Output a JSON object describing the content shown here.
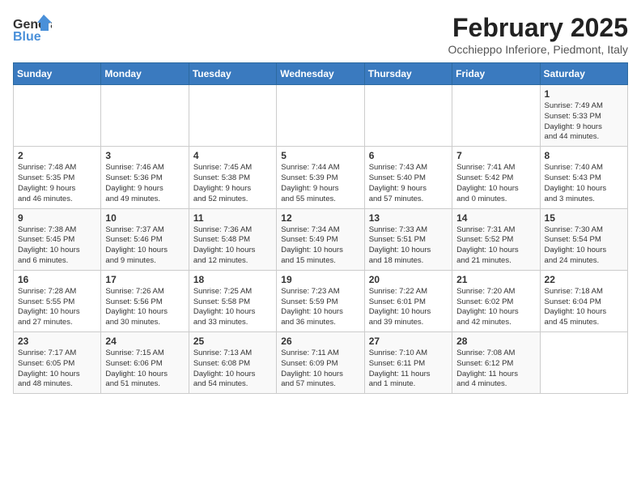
{
  "logo": {
    "line1": "General",
    "line2": "Blue"
  },
  "title": "February 2025",
  "subtitle": "Occhieppo Inferiore, Piedmont, Italy",
  "days_of_week": [
    "Sunday",
    "Monday",
    "Tuesday",
    "Wednesday",
    "Thursday",
    "Friday",
    "Saturday"
  ],
  "weeks": [
    [
      {
        "day": "",
        "info": ""
      },
      {
        "day": "",
        "info": ""
      },
      {
        "day": "",
        "info": ""
      },
      {
        "day": "",
        "info": ""
      },
      {
        "day": "",
        "info": ""
      },
      {
        "day": "",
        "info": ""
      },
      {
        "day": "1",
        "info": "Sunrise: 7:49 AM\nSunset: 5:33 PM\nDaylight: 9 hours\nand 44 minutes."
      }
    ],
    [
      {
        "day": "2",
        "info": "Sunrise: 7:48 AM\nSunset: 5:35 PM\nDaylight: 9 hours\nand 46 minutes."
      },
      {
        "day": "3",
        "info": "Sunrise: 7:46 AM\nSunset: 5:36 PM\nDaylight: 9 hours\nand 49 minutes."
      },
      {
        "day": "4",
        "info": "Sunrise: 7:45 AM\nSunset: 5:38 PM\nDaylight: 9 hours\nand 52 minutes."
      },
      {
        "day": "5",
        "info": "Sunrise: 7:44 AM\nSunset: 5:39 PM\nDaylight: 9 hours\nand 55 minutes."
      },
      {
        "day": "6",
        "info": "Sunrise: 7:43 AM\nSunset: 5:40 PM\nDaylight: 9 hours\nand 57 minutes."
      },
      {
        "day": "7",
        "info": "Sunrise: 7:41 AM\nSunset: 5:42 PM\nDaylight: 10 hours\nand 0 minutes."
      },
      {
        "day": "8",
        "info": "Sunrise: 7:40 AM\nSunset: 5:43 PM\nDaylight: 10 hours\nand 3 minutes."
      }
    ],
    [
      {
        "day": "9",
        "info": "Sunrise: 7:38 AM\nSunset: 5:45 PM\nDaylight: 10 hours\nand 6 minutes."
      },
      {
        "day": "10",
        "info": "Sunrise: 7:37 AM\nSunset: 5:46 PM\nDaylight: 10 hours\nand 9 minutes."
      },
      {
        "day": "11",
        "info": "Sunrise: 7:36 AM\nSunset: 5:48 PM\nDaylight: 10 hours\nand 12 minutes."
      },
      {
        "day": "12",
        "info": "Sunrise: 7:34 AM\nSunset: 5:49 PM\nDaylight: 10 hours\nand 15 minutes."
      },
      {
        "day": "13",
        "info": "Sunrise: 7:33 AM\nSunset: 5:51 PM\nDaylight: 10 hours\nand 18 minutes."
      },
      {
        "day": "14",
        "info": "Sunrise: 7:31 AM\nSunset: 5:52 PM\nDaylight: 10 hours\nand 21 minutes."
      },
      {
        "day": "15",
        "info": "Sunrise: 7:30 AM\nSunset: 5:54 PM\nDaylight: 10 hours\nand 24 minutes."
      }
    ],
    [
      {
        "day": "16",
        "info": "Sunrise: 7:28 AM\nSunset: 5:55 PM\nDaylight: 10 hours\nand 27 minutes."
      },
      {
        "day": "17",
        "info": "Sunrise: 7:26 AM\nSunset: 5:56 PM\nDaylight: 10 hours\nand 30 minutes."
      },
      {
        "day": "18",
        "info": "Sunrise: 7:25 AM\nSunset: 5:58 PM\nDaylight: 10 hours\nand 33 minutes."
      },
      {
        "day": "19",
        "info": "Sunrise: 7:23 AM\nSunset: 5:59 PM\nDaylight: 10 hours\nand 36 minutes."
      },
      {
        "day": "20",
        "info": "Sunrise: 7:22 AM\nSunset: 6:01 PM\nDaylight: 10 hours\nand 39 minutes."
      },
      {
        "day": "21",
        "info": "Sunrise: 7:20 AM\nSunset: 6:02 PM\nDaylight: 10 hours\nand 42 minutes."
      },
      {
        "day": "22",
        "info": "Sunrise: 7:18 AM\nSunset: 6:04 PM\nDaylight: 10 hours\nand 45 minutes."
      }
    ],
    [
      {
        "day": "23",
        "info": "Sunrise: 7:17 AM\nSunset: 6:05 PM\nDaylight: 10 hours\nand 48 minutes."
      },
      {
        "day": "24",
        "info": "Sunrise: 7:15 AM\nSunset: 6:06 PM\nDaylight: 10 hours\nand 51 minutes."
      },
      {
        "day": "25",
        "info": "Sunrise: 7:13 AM\nSunset: 6:08 PM\nDaylight: 10 hours\nand 54 minutes."
      },
      {
        "day": "26",
        "info": "Sunrise: 7:11 AM\nSunset: 6:09 PM\nDaylight: 10 hours\nand 57 minutes."
      },
      {
        "day": "27",
        "info": "Sunrise: 7:10 AM\nSunset: 6:11 PM\nDaylight: 11 hours\nand 1 minute."
      },
      {
        "day": "28",
        "info": "Sunrise: 7:08 AM\nSunset: 6:12 PM\nDaylight: 11 hours\nand 4 minutes."
      },
      {
        "day": "",
        "info": ""
      }
    ]
  ]
}
